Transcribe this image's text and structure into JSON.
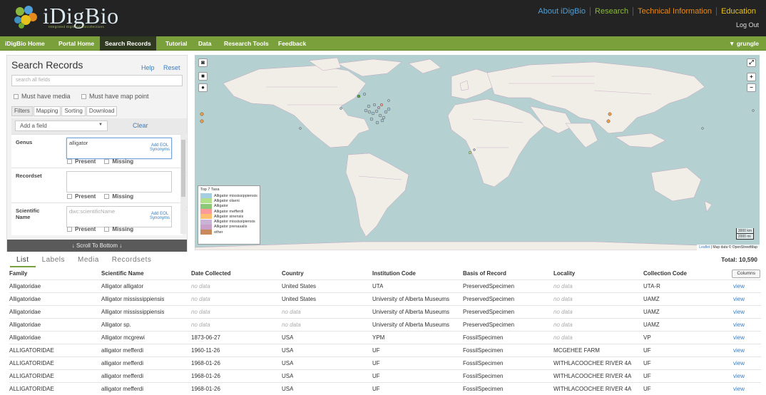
{
  "brand": {
    "name": "iDigBio",
    "tagline": "Integrated Digitized Biocollections"
  },
  "top_links": [
    {
      "label": "About iDigBio",
      "color": "#4f9fd8"
    },
    {
      "label": "Research",
      "color": "#8ab83c"
    },
    {
      "label": "Technical Information",
      "color": "#e58a1f"
    },
    {
      "label": "Education",
      "color": "#e8c21c"
    }
  ],
  "logout_label": "Log Out",
  "nav": {
    "items": [
      "iDigBio Home",
      "Portal Home",
      "Search Records",
      "Tutorial",
      "Data",
      "Research Tools",
      "Feedback"
    ],
    "active": "Search Records",
    "user": "▼ grungle"
  },
  "search": {
    "title": "Search Records",
    "help": "Help",
    "reset": "Reset",
    "placeholder": "search all fields",
    "must_have_media": "Must have media",
    "must_have_map_point": "Must have map point",
    "tabs": [
      "Filters",
      "Mapping",
      "Sorting",
      "Download"
    ],
    "add_field": "Add a field",
    "clear": "Clear",
    "filters": [
      {
        "label": "Genus",
        "value": "alligator",
        "placeholder": "",
        "synonyms": "Add EOL Synonyms",
        "present": "Present",
        "missing": "Missing"
      },
      {
        "label": "Recordset",
        "value": "",
        "placeholder": "",
        "synonyms": "",
        "present": "Present",
        "missing": "Missing"
      },
      {
        "label": "Scientific Name",
        "value": "",
        "placeholder": "dwc:scientificName",
        "synonyms": "Add EOL Synonyms",
        "present": "Present",
        "missing": "Missing"
      }
    ],
    "scroll_bottom": "↓ Scroll To Bottom ↓"
  },
  "map": {
    "controls": {
      "screenshot": "camera-icon",
      "draw_rect": "■",
      "draw_point": "●",
      "fullscreen": "⤢",
      "zoom_in": "+",
      "zoom_out": "−"
    },
    "legend": {
      "title": "Top 7 Taxa",
      "items": [
        {
          "label": "Alligator mississippiensis",
          "color": "#a6cee3"
        },
        {
          "label": "Alligator olseni",
          "color": "#b2df8a"
        },
        {
          "label": "Alligator",
          "color": "#8cc878"
        },
        {
          "label": "Alligator mefferdi",
          "color": "#fb9a99"
        },
        {
          "label": "Alligator sinensis",
          "color": "#fdbf6f"
        },
        {
          "label": "Alligator mississipiensis",
          "color": "#cab2d6"
        },
        {
          "label": "Alligator prenasalis",
          "color": "#c9a0c8"
        },
        {
          "label": "other",
          "color": "#c88a5a"
        }
      ]
    },
    "scale": {
      "km": "3000 km",
      "mi": "2000 mi"
    },
    "attribution_link": "Leaflet",
    "attribution": "| Map data © OpenStreetMap"
  },
  "results": {
    "tabs": [
      "List",
      "Labels",
      "Media",
      "Recordsets"
    ],
    "active_tab": "List",
    "total": "Total: 10,590",
    "columns_button": "Columns",
    "headers": [
      "Family",
      "Scientific Name",
      "Date Collected",
      "Country",
      "Institution Code",
      "Basis of Record",
      "Locality",
      "Collection Code",
      ""
    ],
    "rows": [
      [
        "Alligatoridae",
        "Alligator alligator",
        "no data",
        "United States",
        "UTA",
        "PreservedSpecimen",
        "no data",
        "UTA-R",
        "view"
      ],
      [
        "Alligatoridae",
        "Alligator mississippiensis",
        "no data",
        "United States",
        "University of Alberta Museums",
        "PreservedSpecimen",
        "no data",
        "UAMZ",
        "view"
      ],
      [
        "Alligatoridae",
        "Alligator mississippiensis",
        "no data",
        "no data",
        "University of Alberta Museums",
        "PreservedSpecimen",
        "no data",
        "UAMZ",
        "view"
      ],
      [
        "Alligatoridae",
        "Alligator sp.",
        "no data",
        "no data",
        "University of Alberta Museums",
        "PreservedSpecimen",
        "no data",
        "UAMZ",
        "view"
      ],
      [
        "Alligatoridae",
        "Alligator mcgrewi",
        "1873-06-27",
        "USA",
        "YPM",
        "FossilSpecimen",
        "no data",
        "VP",
        "view"
      ],
      [
        "ALLIGATORIDAE",
        "alligator mefferdi",
        "1960-11-26",
        "USA",
        "UF",
        "FossilSpecimen",
        "MCGEHEE FARM",
        "UF",
        "view"
      ],
      [
        "ALLIGATORIDAE",
        "alligator mefferdi",
        "1968-01-26",
        "USA",
        "UF",
        "FossilSpecimen",
        "WITHLACOOCHEE RIVER 4A",
        "UF",
        "view"
      ],
      [
        "ALLIGATORIDAE",
        "alligator mefferdi",
        "1968-01-26",
        "USA",
        "UF",
        "FossilSpecimen",
        "WITHLACOOCHEE RIVER 4A",
        "UF",
        "view"
      ],
      [
        "ALLIGATORIDAE",
        "alligator mefferdi",
        "1968-01-26",
        "USA",
        "UF",
        "FossilSpecimen",
        "WITHLACOOCHEE RIVER 4A",
        "UF",
        "view"
      ]
    ]
  }
}
